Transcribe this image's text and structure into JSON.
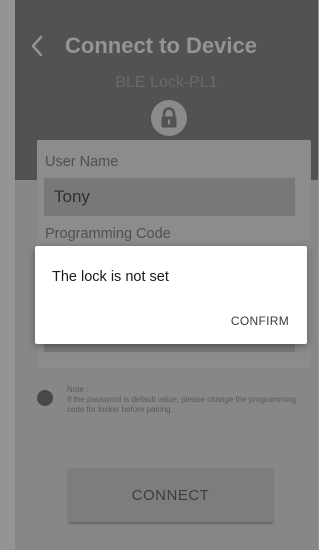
{
  "header": {
    "title": "Connect to Device",
    "device_name": "BLE Lock-PL1",
    "back_icon": "chevron-left-icon",
    "lock_icon": "lock-icon"
  },
  "form": {
    "user_name_label": "User Name",
    "user_name_value": "Tony",
    "programming_code_label": "Programming Code"
  },
  "note": {
    "title": "Note :",
    "text": "If the password is default value, please change the programming code for locker before pairing."
  },
  "connect_label": "CONNECT",
  "dialog": {
    "message": "The lock is not set",
    "confirm_label": "CONFIRM"
  },
  "colors": {
    "header_bg": "#8d8d8d",
    "screen_bg": "#e9e9e9",
    "input_bg": "#cfcfcf",
    "dialog_bg": "#ffffff"
  }
}
